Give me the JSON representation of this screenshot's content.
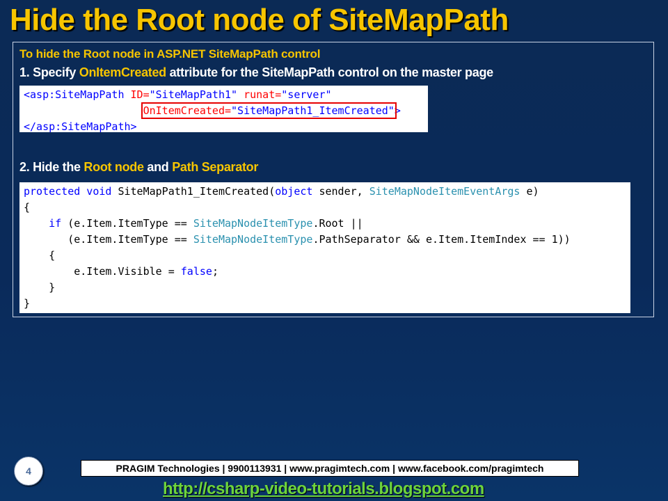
{
  "slide": {
    "title": "Hide the Root node of SiteMapPath",
    "subheading": "To hide the Root node in ASP.NET SiteMapPath control",
    "step1": {
      "prefix": "1. Specify ",
      "highlight": "OnItemCreated",
      "suffix": " attribute for the SiteMapPath control on the master page"
    },
    "step2": {
      "prefix": "2. Hide the ",
      "highlight1": "Root node",
      "middle": " and ",
      "highlight2": "Path  Separator"
    },
    "markup_code": {
      "l1_open": "<asp:SiteMapPath",
      "l1_attr1": " ID=",
      "l1_val1": "\"SiteMapPath1\"",
      "l1_attr2": " runat=",
      "l1_val2": "\"server\"",
      "l2_indent": "                   ",
      "l2_attr": "OnItemCreated=",
      "l2_val": "\"SiteMapPath1_ItemCreated\"",
      "l2_close": ">",
      "l3": "</asp:SiteMapPath>"
    },
    "csharp_code": {
      "l1_kw": "protected void",
      "l1_name": " SiteMapPath1_ItemCreated(",
      "l1_obj": "object",
      "l1_sender": " sender, ",
      "l1_type": "SiteMapNodeItemEventArgs",
      "l1_end": " e)",
      "l2": "{",
      "l3_indent": "    ",
      "l3_if": "if",
      "l3_a": " (e.Item.ItemType == ",
      "l3_type": "SiteMapNodeItemType",
      "l3_b": ".Root ||",
      "l4_a": "       (e.Item.ItemType == ",
      "l4_type": "SiteMapNodeItemType",
      "l4_b": ".PathSeparator && e.Item.ItemIndex == 1))",
      "l5": "    {",
      "l6_a": "        e.Item.Visible = ",
      "l6_false": "false",
      "l6_b": ";",
      "l7": "    }",
      "l8": "}"
    },
    "page_number": "4",
    "footer": "PRAGIM Technologies | 9900113931 | www.pragimtech.com | www.facebook.com/pragimtech",
    "blog_link": "http://csharp-video-tutorials.blogspot.com"
  }
}
